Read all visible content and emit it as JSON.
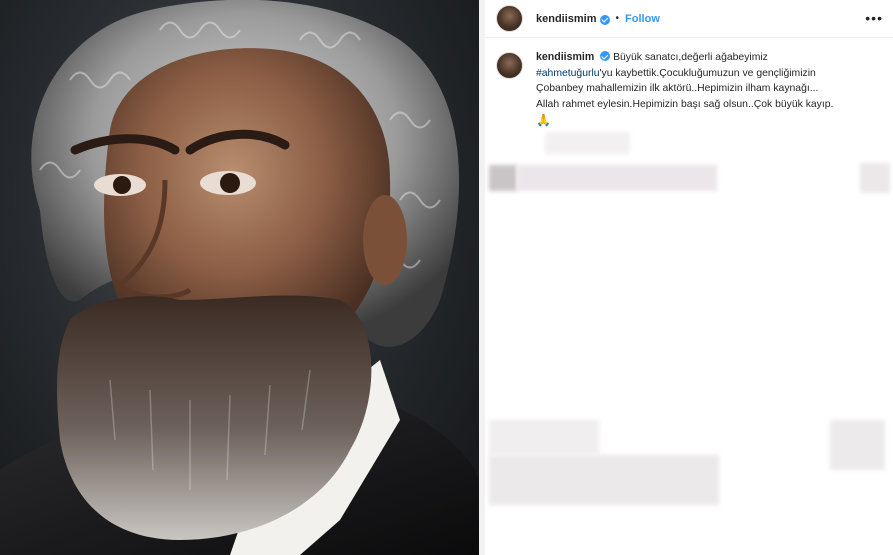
{
  "post": {
    "username": "kendiismim",
    "separator": "•",
    "follow_label": "Follow",
    "more_icon": "•••",
    "caption": {
      "username": "kendiismim",
      "line1": "Büyük sanatcı,değerli ağabeyimiz",
      "hashtag": "#ahmetuğurlu",
      "line2_rest": "'yu kaybettik.Çocukluğumuzun ve gençliğimizin",
      "line3": "Çobanbey mahallemizin ilk aktörü..Hepimizin ilham kaynağı...",
      "line4": "Allah rahmet eylesin.Hepimizin başı sağ olsun..Çok büyük kayıp.",
      "emoji": "🙏"
    }
  },
  "colors": {
    "link": "#3897f0",
    "hashtag": "#00376b",
    "verified": "#3897f0"
  },
  "icons": {
    "verified": "verified-badge-icon",
    "more": "more-options-icon",
    "emoji": "praying-hands-emoji"
  }
}
